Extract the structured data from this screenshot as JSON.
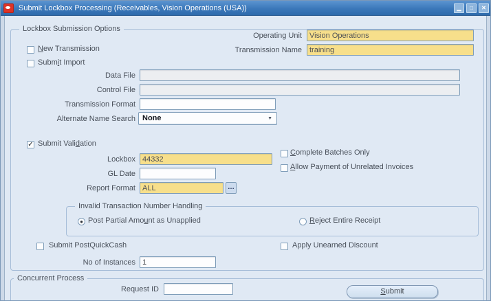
{
  "titlebar": {
    "title": "Submit Lockbox Processing (Receivables, Vision Operations (USA))",
    "minimize_glyph": "▁",
    "maximize_glyph": "□",
    "close_glyph": "✕"
  },
  "colors": {
    "titlebar_blue": "#3b78ba",
    "canvas": "#e0e9f4",
    "required_field_yellow": "#f7df8b",
    "field_border": "#7f9db9",
    "oracle_red": "#dd3327"
  },
  "form": {
    "legend": "Lockbox Submission Options",
    "operating_unit": {
      "label": "Operating Unit",
      "value": "Vision Operations"
    },
    "transmission_name": {
      "label": "Transmission Name",
      "value": "training"
    },
    "new_transmission": {
      "label": "New Transmission",
      "checked": false,
      "glyph": ""
    },
    "submit_import": {
      "label": "Submit Import",
      "checked": false,
      "glyph": ""
    },
    "data_file": {
      "label": "Data File",
      "value": ""
    },
    "control_file": {
      "label": "Control File",
      "value": ""
    },
    "transmission_format": {
      "label": "Transmission Format",
      "value": ""
    },
    "alternate_name_search": {
      "label": "Alternate Name Search",
      "value": "None",
      "dropdown_glyph": "▼"
    },
    "submit_validation": {
      "label": "Submit Validation",
      "checked": true,
      "glyph": "✓"
    },
    "lockbox": {
      "label": "Lockbox",
      "value": "44332"
    },
    "complete_batches_only": {
      "label": "Complete Batches Only",
      "checked": false,
      "glyph": ""
    },
    "gl_date": {
      "label": "GL Date",
      "value": ""
    },
    "allow_payment_unrelated": {
      "label": "Allow Payment of Unrelated Invoices",
      "checked": false,
      "glyph": ""
    },
    "report_format": {
      "label": "Report Format",
      "value": "ALL",
      "lov_glyph": "…"
    },
    "invalid_txn_handling": {
      "legend": "Invalid Transaction Number Handling",
      "post_partial": {
        "label": "Post Partial Amount as Unapplied",
        "selected": true,
        "glyph": "●"
      },
      "reject_entire": {
        "label": "Reject Entire Receipt",
        "selected": false,
        "glyph": ""
      }
    },
    "submit_postquickcash": {
      "label": "Submit PostQuickCash",
      "checked": false,
      "glyph": ""
    },
    "apply_unearned_discount": {
      "label": "Apply Unearned Discount",
      "checked": false,
      "glyph": ""
    },
    "no_of_instances": {
      "label": "No of Instances",
      "value": "1"
    }
  },
  "concurrent": {
    "legend": "Concurrent Process",
    "request_id": {
      "label": "Request ID",
      "value": ""
    },
    "submit_button_label": "Submit"
  }
}
